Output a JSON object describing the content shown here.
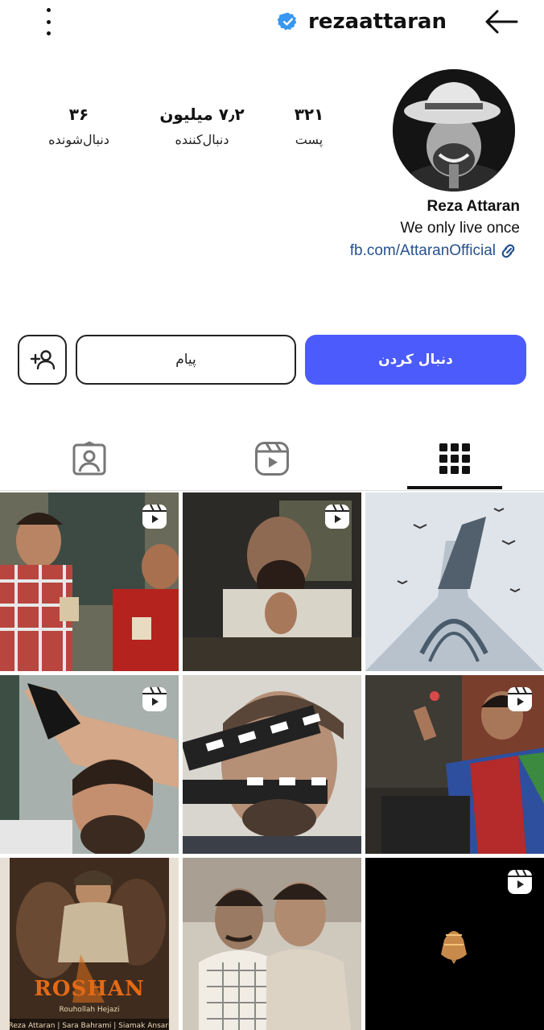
{
  "header": {
    "username": "rezaattaran"
  },
  "profile": {
    "display_name": "Reza Attaran",
    "bio_line": "We only live once",
    "link": "fb.com/AttaranOfficial"
  },
  "stats": [
    {
      "value": "۳۲۱",
      "label": "پست"
    },
    {
      "value": "۷٫۲ میلیون",
      "label": "دنبال‌کننده"
    },
    {
      "value": "۳۶",
      "label": "دنبال‌شونده"
    }
  ],
  "actions": {
    "follow_label": "دنبال کردن",
    "message_label": "پیام"
  },
  "tabs": [
    {
      "icon": "grid-icon",
      "active": true
    },
    {
      "icon": "reels-icon",
      "active": false
    },
    {
      "icon": "tagged-icon",
      "active": false
    }
  ],
  "grid": {
    "posters": [
      {
        "title": "ROSHAN",
        "director": "Rouhollah Hejazi",
        "cast": "Reza Attaran | Sara Bahrami | Siamak Ansari"
      }
    ]
  },
  "colors": {
    "accent": "#4c5bfb",
    "link": "#27518f",
    "verified": "#3897f0"
  }
}
